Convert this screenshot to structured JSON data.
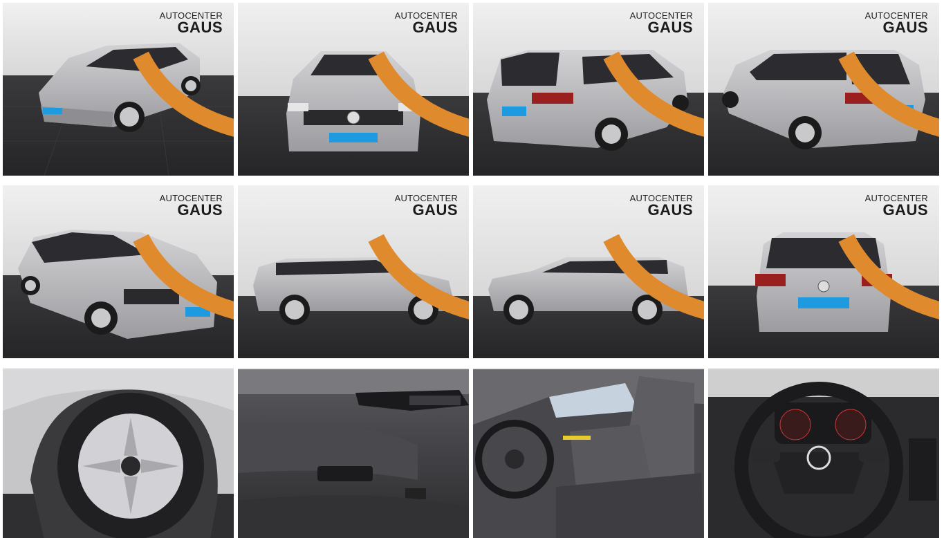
{
  "gallery": {
    "dealer_logo": {
      "line1": "AUTOCENTER",
      "line2": "GAUS"
    },
    "photos": [
      {
        "view": "front-left three-quarter exterior"
      },
      {
        "view": "front exterior"
      },
      {
        "view": "rear-left three-quarter exterior"
      },
      {
        "view": "rear-right three-quarter exterior"
      },
      {
        "view": "front-right three-quarter exterior"
      },
      {
        "view": "right side profile"
      },
      {
        "view": "left side profile"
      },
      {
        "view": "rear exterior"
      },
      {
        "view": "alloy wheel close-up"
      },
      {
        "view": "door panel interior"
      },
      {
        "view": "front seats interior"
      },
      {
        "view": "steering wheel and cockpit"
      }
    ]
  },
  "colors": {
    "backdrop_wall": "#e4e4e4",
    "floor": "#2f2f31",
    "car_silver": "#b9b9bc",
    "logo_orange": "#e08a2e",
    "plate_blue": "#1e9be0"
  }
}
